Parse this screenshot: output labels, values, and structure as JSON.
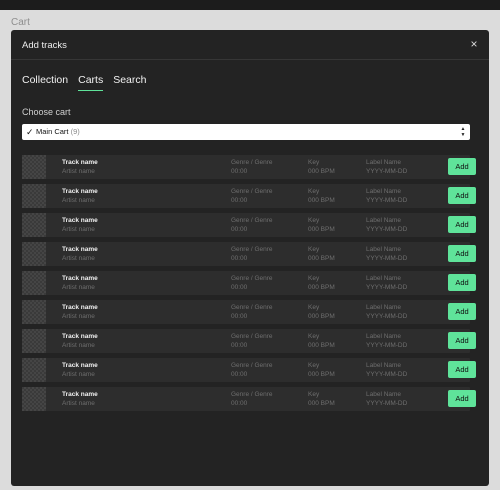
{
  "page": {
    "title": "Cart"
  },
  "modal": {
    "title": "Add tracks",
    "close_icon": "×"
  },
  "tabs": [
    {
      "label": "Collection",
      "active": false
    },
    {
      "label": "Carts",
      "active": true
    },
    {
      "label": "Search",
      "active": false
    }
  ],
  "cart_select": {
    "label": "Choose cart",
    "check_icon": "✓",
    "selected_name": "Main Cart",
    "selected_count": "(9)",
    "arrows_icon": "▲▼"
  },
  "accent_color": "#5fe39a",
  "tracks": [
    {
      "name": "Track name",
      "artist": "Artist name",
      "genre": "Genre / Genre",
      "time": "00:00",
      "key": "Key",
      "bpm": "000 BPM",
      "label": "Label Name",
      "date": "YYYY-MM-DD",
      "add_label": "Add"
    },
    {
      "name": "Track name",
      "artist": "Artist name",
      "genre": "Genre / Genre",
      "time": "00:00",
      "key": "Key",
      "bpm": "000 BPM",
      "label": "Label Name",
      "date": "YYYY-MM-DD",
      "add_label": "Add"
    },
    {
      "name": "Track name",
      "artist": "Artist name",
      "genre": "Genre / Genre",
      "time": "00:00",
      "key": "Key",
      "bpm": "000 BPM",
      "label": "Label Name",
      "date": "YYYY-MM-DD",
      "add_label": "Add"
    },
    {
      "name": "Track name",
      "artist": "Artist name",
      "genre": "Genre / Genre",
      "time": "00:00",
      "key": "Key",
      "bpm": "000 BPM",
      "label": "Label Name",
      "date": "YYYY-MM-DD",
      "add_label": "Add"
    },
    {
      "name": "Track name",
      "artist": "Artist name",
      "genre": "Genre / Genre",
      "time": "00:00",
      "key": "Key",
      "bpm": "000 BPM",
      "label": "Label Name",
      "date": "YYYY-MM-DD",
      "add_label": "Add"
    },
    {
      "name": "Track name",
      "artist": "Artist name",
      "genre": "Genre / Genre",
      "time": "00:00",
      "key": "Key",
      "bpm": "000 BPM",
      "label": "Label Name",
      "date": "YYYY-MM-DD",
      "add_label": "Add"
    },
    {
      "name": "Track name",
      "artist": "Artist name",
      "genre": "Genre / Genre",
      "time": "00:00",
      "key": "Key",
      "bpm": "000 BPM",
      "label": "Label Name",
      "date": "YYYY-MM-DD",
      "add_label": "Add"
    },
    {
      "name": "Track name",
      "artist": "Artist name",
      "genre": "Genre / Genre",
      "time": "00:00",
      "key": "Key",
      "bpm": "000 BPM",
      "label": "Label Name",
      "date": "YYYY-MM-DD",
      "add_label": "Add"
    },
    {
      "name": "Track name",
      "artist": "Artist name",
      "genre": "Genre / Genre",
      "time": "00:00",
      "key": "Key",
      "bpm": "000 BPM",
      "label": "Label Name",
      "date": "YYYY-MM-DD",
      "add_label": "Add"
    }
  ]
}
